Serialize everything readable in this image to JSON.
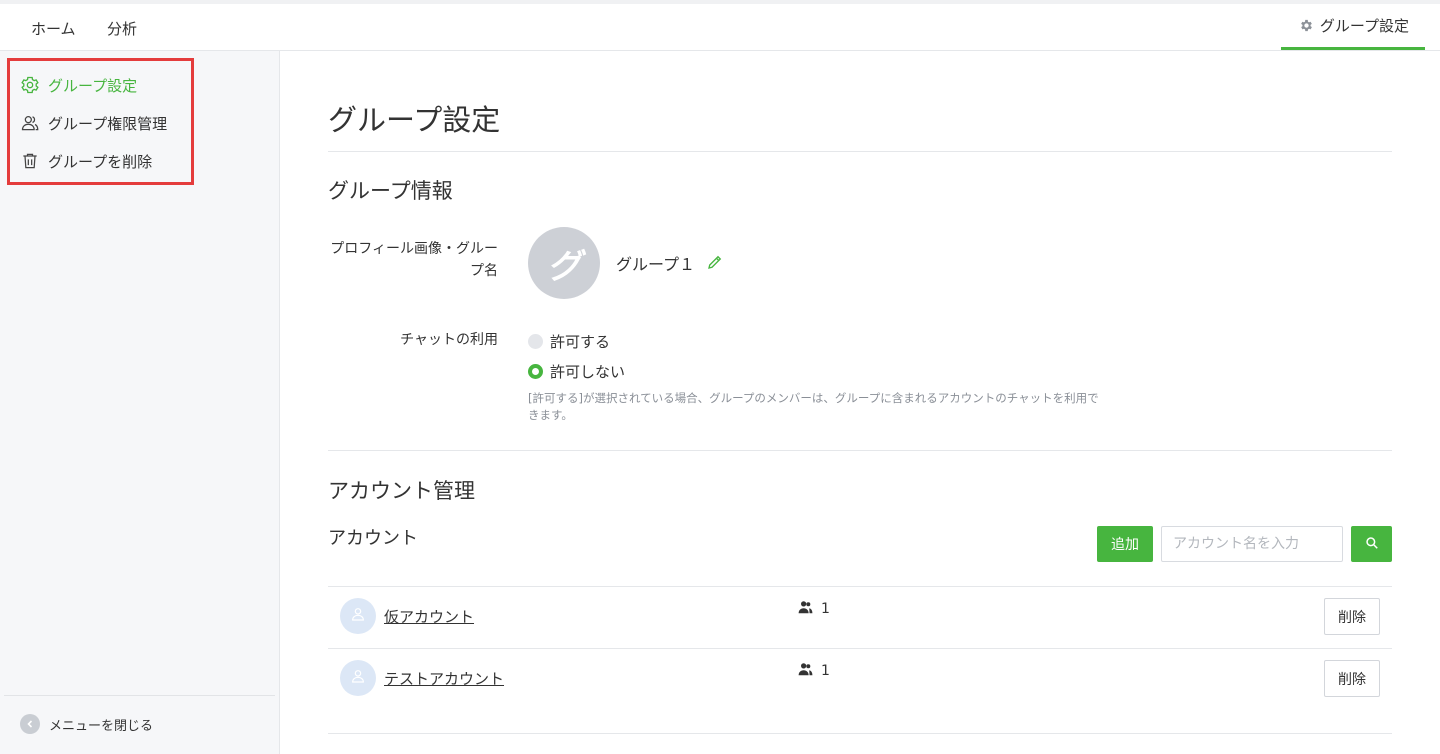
{
  "topnav": {
    "home": "ホーム",
    "analysis": "分析",
    "group_settings": "グループ設定"
  },
  "sidebar": {
    "items": [
      {
        "label": "グループ設定",
        "icon": "gear-icon",
        "active": true
      },
      {
        "label": "グループ権限管理",
        "icon": "users-icon",
        "active": false
      },
      {
        "label": "グループを削除",
        "icon": "trash-icon",
        "active": false
      }
    ],
    "close_menu": "メニューを閉じる"
  },
  "main": {
    "title": "グループ設定",
    "group_info": {
      "heading": "グループ情報",
      "profile_label": "プロフィール画像・グループ名",
      "avatar_letter": "グ",
      "group_name": "グループ１",
      "chat_label": "チャットの利用",
      "radio_allow": "許可する",
      "radio_deny": "許可しない",
      "selected": "許可しない",
      "hint": "[許可する]が選択されている場合、グループのメンバーは、グループに含まれるアカウントのチャットを利用できます。"
    },
    "account_mgmt": {
      "heading": "アカウント管理",
      "subheading": "アカウント",
      "add_button": "追加",
      "search_placeholder": "アカウント名を入力",
      "rows": [
        {
          "name": "仮アカウント",
          "members": "1",
          "delete": "削除"
        },
        {
          "name": "テストアカウント",
          "members": "1",
          "delete": "削除"
        }
      ]
    }
  },
  "colors": {
    "accent": "#47b53f",
    "highlight_box": "#e43c3c",
    "sidebar_bg": "#f6f7f9"
  }
}
